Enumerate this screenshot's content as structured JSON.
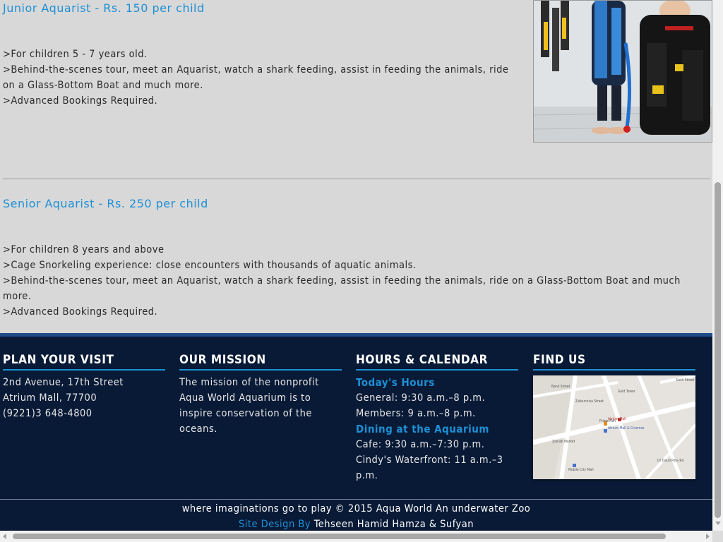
{
  "junior": {
    "title": "Junior Aquarist - Rs. 150 per child",
    "lines": [
      ">For children 5 - 7 years old.",
      ">Behind-the-scenes tour, meet an Aquarist, watch a shark feeding, assist in feeding the animals, ride on a Glass-Bottom Boat and much more.",
      ">Advanced Bookings Required."
    ]
  },
  "senior": {
    "title": "Senior Aquarist - Rs. 250 per child",
    "lines": [
      ">For children 8 years and above",
      ">Cage Snorkeling experience: close encounters with thousands of aquatic animals.",
      ">Behind-the-scenes tour, meet an Aquarist, watch a shark feeding, assist in feeding the animals, ride on a Glass-Bottom Boat and much more.",
      ">Advanced Bookings Required."
    ]
  },
  "footer": {
    "visit": {
      "heading": "PLAN YOUR VISIT",
      "lines": [
        "2nd Avenue, 17th Street",
        "Atrium Mall, 77700",
        "(9221)3 648-4800"
      ]
    },
    "mission": {
      "heading": "OUR MISSION",
      "text": "The mission of the nonprofit Aqua World Aquarium is to inspire conservation of the oceans."
    },
    "hours": {
      "heading": "HOURS & CALENDAR",
      "today_label": "Today's Hours",
      "general": "General: 9:30 a.m.–8 p.m.",
      "members": "Members: 9 a.m.–8 p.m.",
      "dining_label": "Dining at the Aquarium",
      "cafe": "Cafe: 9:30 a.m.–7:30 p.m.",
      "cindys": "Cindy's Waterfront: 11 a.m.–3 p.m."
    },
    "find": {
      "heading": "FIND US",
      "map_labels": [
        "Gold Tower",
        "Atrium Mall",
        "Atrium Mall & Cinemas",
        "Zainab Market",
        "Mobile City Mall",
        "Prime Fish",
        "Sixth Street",
        "Bank Street",
        "Zaibunnisa Street",
        "Dr Daud Pota Rd"
      ]
    },
    "copyright": "where imaginations go to play © 2015 Aqua World An underwater Zoo",
    "credit_label": "Site Design By",
    "credit_names": "Tehseen Hamid Hamza & Sufyan"
  },
  "colors": {
    "accent": "#1e90d6",
    "footer_bg": "#081a36",
    "page_bg": "#d8d8d8"
  }
}
